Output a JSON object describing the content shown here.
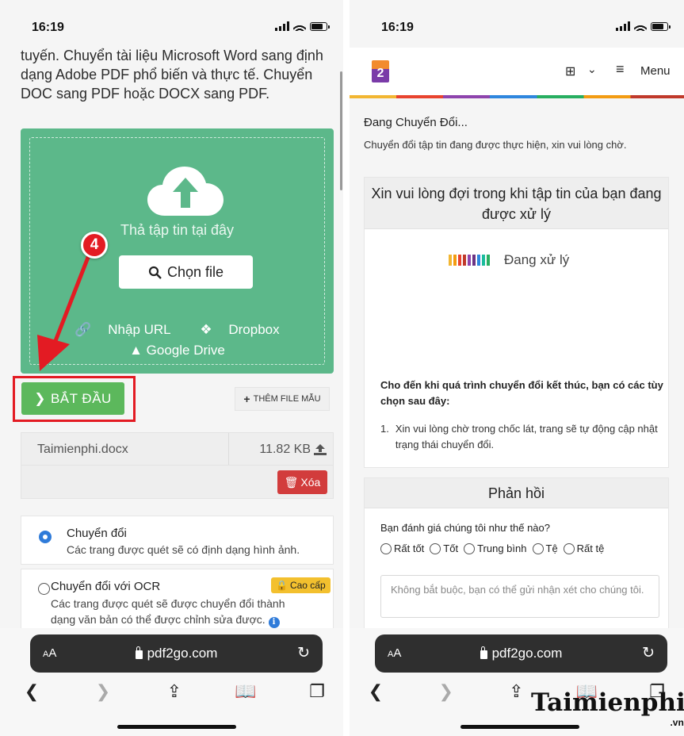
{
  "left": {
    "status": {
      "time": "16:19"
    },
    "intro_text": "tuyến. Chuyển tài liệu Microsoft Word sang định dạng Adobe PDF phổ biến và thực tế. Chuyển DOC sang PDF hoặc DOCX sang PDF.",
    "dropzone": {
      "drop_text": "Thả tập tin tại đây",
      "choose_file": "Chọn file",
      "import_url": "Nhập URL",
      "dropbox": "Dropbox",
      "google_drive": "Google Drive"
    },
    "step_badge": "4",
    "start_button": "BẮT ĐẦU",
    "add_sample_button": "THÊM FILE MẪU",
    "file": {
      "name": "Taimienphi.docx",
      "size": "11.82 KB",
      "delete_label": "Xóa"
    },
    "options": [
      {
        "title": "Chuyển đổi",
        "description": "Các trang được quét sẽ có định dạng hình ảnh.",
        "selected": true
      },
      {
        "title": "Chuyển đổi với OCR",
        "description": "Các trang được quét sẽ được chuyển đổi thành dạng văn bản có thể được chỉnh sửa được.",
        "badge": "Cao cấp",
        "selected": false
      }
    ],
    "browser": {
      "aa": "AA",
      "url": "pdf2go.com"
    }
  },
  "right": {
    "status": {
      "time": "16:19"
    },
    "header": {
      "logo": "2",
      "menu_label": "Menu"
    },
    "converting_title": "Đang Chuyển Đổi...",
    "converting_sub": "Chuyển đổi tập tin đang được thực hiện, xin vui lòng chờ.",
    "wait_card": {
      "heading": "Xin vui lòng đợi trong khi tập tin của bạn đang được xử lý",
      "processing": "Đang xử lý",
      "bar_colors": [
        "#f2b632",
        "#f39c12",
        "#e8432e",
        "#c0392b",
        "#8e44ad",
        "#6c3483",
        "#2e86de",
        "#1abc9c",
        "#27ae60"
      ],
      "note": "Cho đến khi quá trình chuyển đổi kết thúc, bạn có các tùy chọn sau đây:",
      "list": [
        {
          "num": "1.",
          "text": "Xin vui lòng chờ trong chốc lát, trang sẽ tự động cập nhật trạng thái chuyển đổi."
        }
      ]
    },
    "feedback": {
      "heading": "Phản hồi",
      "question": "Bạn đánh giá chúng tôi như thế nào?",
      "ratings": [
        "Rất tốt",
        "Tốt",
        "Trung bình",
        "Tệ",
        "Rất tệ"
      ],
      "comment_placeholder": "Không bắt buộc, bạn có thể gửi nhận xét cho chúng tôi."
    },
    "browser": {
      "aa": "AA",
      "url": "pdf2go.com"
    }
  },
  "watermark": {
    "text": "Taimienphi",
    "suffix": ".vn"
  },
  "colors": {
    "dropzone": "#5cb88a",
    "start": "#5cb85c",
    "highlight": "#e31b23",
    "delete": "#d23c3c",
    "premium": "#f3c02e",
    "radio": "#2f7bd9"
  }
}
